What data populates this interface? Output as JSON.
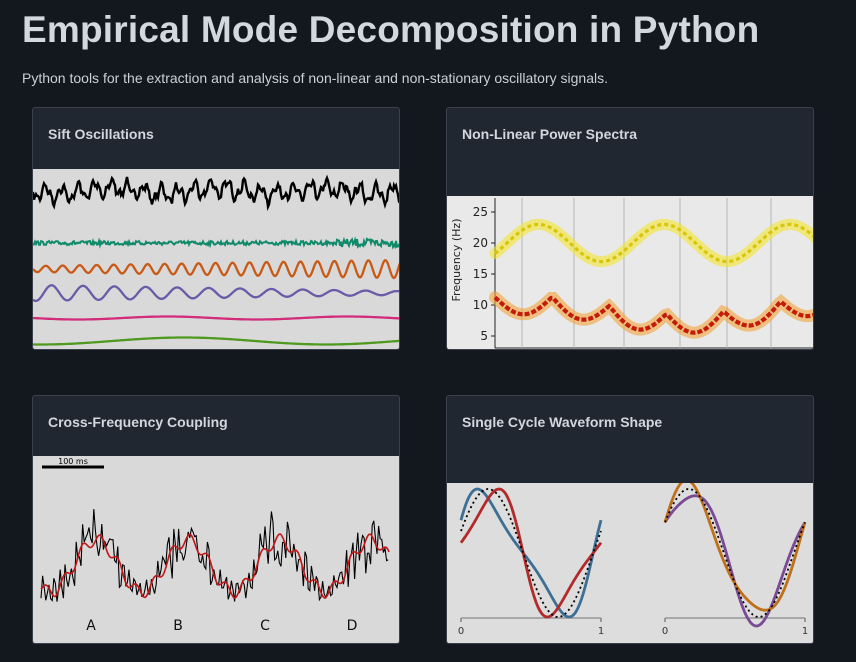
{
  "page": {
    "title": "Empirical Mode Decomposition in Python",
    "subtitle": "Python tools for the extraction and analysis of non-linear and non-stationary oscillatory signals."
  },
  "cards": [
    {
      "title": "Sift Oscillations"
    },
    {
      "title": "Non-Linear Power Spectra",
      "ylabel": "Frequency (Hz)",
      "yticks": [
        "25",
        "20",
        "15",
        "10",
        "5"
      ]
    },
    {
      "title": "Cross-Frequency Coupling",
      "scale_label": "100 ms",
      "cycle_labels": [
        "A",
        "B",
        "C",
        "D"
      ]
    },
    {
      "title": "Single Cycle Waveform Shape",
      "xticks": [
        "0",
        "1",
        "0",
        "1"
      ]
    }
  ],
  "colors": {
    "background": "#13171e",
    "card": "#212731",
    "imf_black": "#000000",
    "imf_teal": "#0f8a6a",
    "imf_orange": "#c95a16",
    "imf_purple": "#6a5aa8",
    "imf_pink": "#d22c7a",
    "imf_green": "#4d9a1f",
    "spectrum_red": "#c31c08",
    "spectrum_yellow": "#f4e61e",
    "coupling_red": "#c41616",
    "wave_blue": "#3d6f95",
    "wave_red": "#b22a2a",
    "wave_purple": "#7a4a94",
    "wave_orange": "#c07018"
  }
}
